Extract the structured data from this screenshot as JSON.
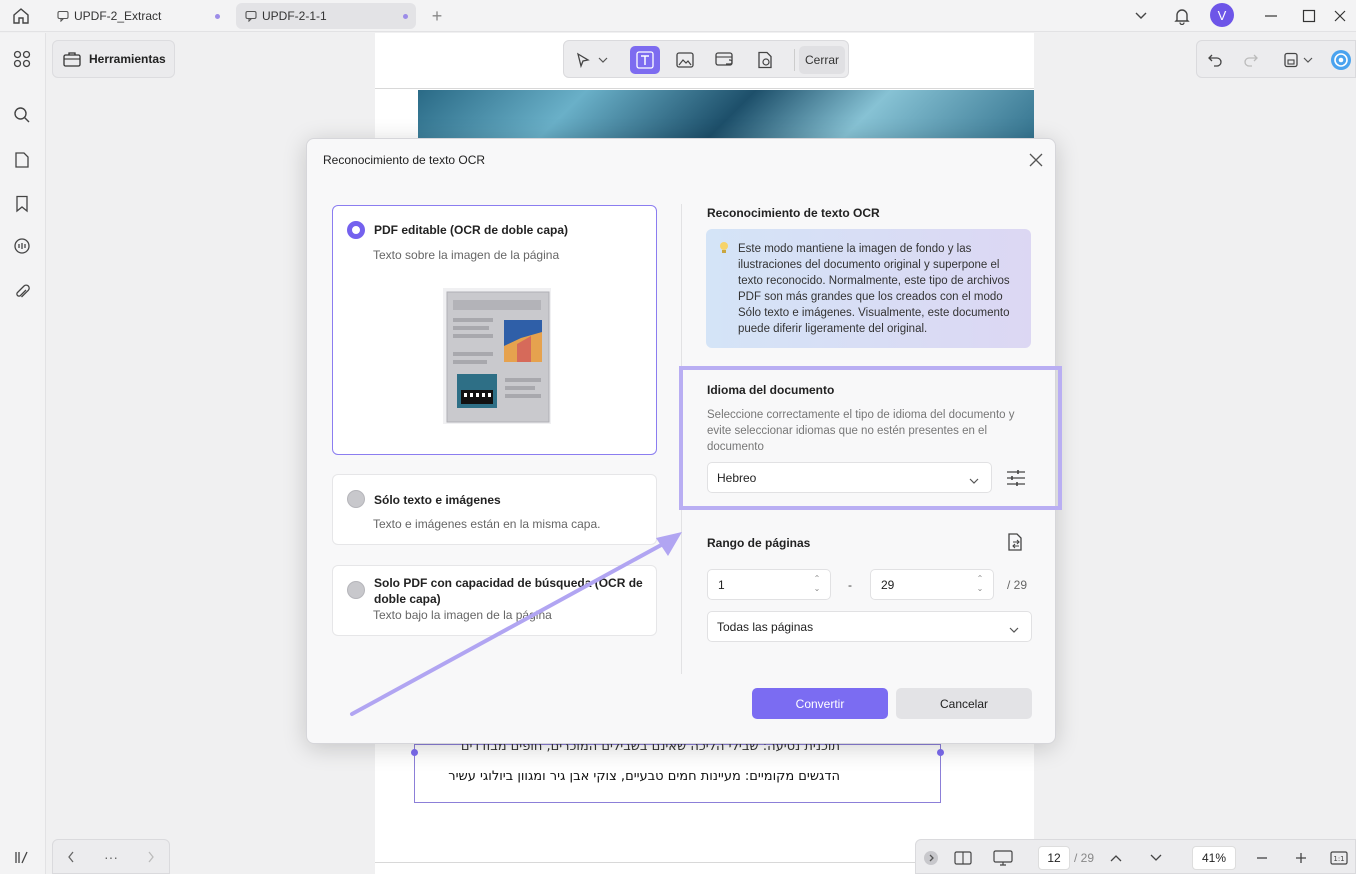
{
  "tabs": [
    {
      "label": "UPDF-2_Extract"
    },
    {
      "label": "UPDF-2-1-1"
    }
  ],
  "user": {
    "initial": "V"
  },
  "toolbar": {
    "herramientas": "Herramientas",
    "cerrar": "Cerrar"
  },
  "document": {
    "line1": "תוכנית נסיעה: שבילי הליכה שאינם בשבילים המוכרים, חופים מבודדים",
    "line2": "הדגשים מקומיים: מעיינות חמים טבעיים, צוקי אבן גיר ומגוון ביולוגי עשיר"
  },
  "dialog": {
    "title": "Reconocimiento de texto OCR",
    "options": [
      {
        "title": "PDF editable (OCR de doble capa)",
        "desc": "Texto sobre la imagen de la página",
        "selected": true
      },
      {
        "title": "Sólo texto e imágenes",
        "desc": "Texto e imágenes están en la misma capa.",
        "selected": false
      },
      {
        "title": "Solo PDF con capacidad de búsqueda (OCR de doble capa)",
        "desc": "Texto bajo la imagen de la página",
        "selected": false
      }
    ],
    "ocr_title": "Reconocimiento de texto OCR",
    "ocr_info": "Este modo mantiene la imagen de fondo y las ilustraciones del documento original y superpone el texto reconocido. Normalmente, este tipo de archivos PDF son más grandes que los creados con el modo Sólo texto e imágenes. Visualmente, este documento puede diferir ligeramente del original.",
    "language_title": "Idioma del documento",
    "language_desc": "Seleccione correctamente el tipo de idioma del documento y evite seleccionar idiomas que no estén presentes en el documento",
    "language_value": "Hebreo",
    "range_title": "Rango de páginas",
    "range_from": "1",
    "range_to": "29",
    "range_total": "/ 29",
    "range_sep": "-",
    "range_mode": "Todas las páginas",
    "convert": "Convertir",
    "cancel": "Cancelar"
  },
  "statusbar": {
    "page": "12",
    "total": "/ 29",
    "zoom": "41%",
    "more": "···"
  },
  "colors": {
    "accent": "#7b6cf2",
    "highlight": "#b9aef3"
  }
}
